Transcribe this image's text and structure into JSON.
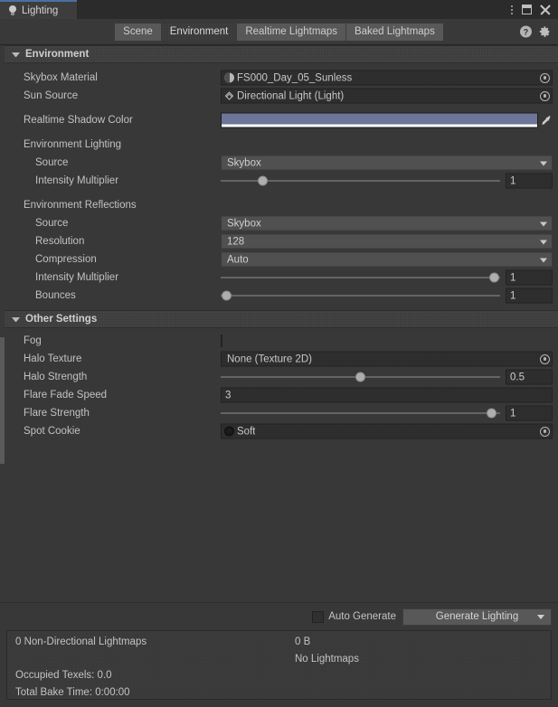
{
  "window": {
    "tab_title": "Lighting",
    "tab_icon": "lightbulb-icon",
    "controls": {
      "menu": "kebab-menu-icon",
      "maximize": "maximize-icon",
      "close": "close-icon"
    }
  },
  "toolbar": {
    "tabs": [
      {
        "label": "Scene",
        "active": false
      },
      {
        "label": "Environment",
        "active": true
      },
      {
        "label": "Realtime Lightmaps",
        "active": false
      },
      {
        "label": "Baked Lightmaps",
        "active": false
      }
    ],
    "help_label": "?",
    "help_icon": "help-icon",
    "settings_icon": "gear-icon"
  },
  "sections": {
    "environment": {
      "title": "Environment",
      "skybox_material": {
        "label": "Skybox Material",
        "value": "FS000_Day_05_Sunless",
        "icon": "material-icon"
      },
      "sun_source": {
        "label": "Sun Source",
        "value": "Directional Light (Light)",
        "icon": "light-icon"
      },
      "realtime_shadow_color": {
        "label": "Realtime Shadow Color",
        "color": "#6d7599",
        "alpha_color": "#ffffff",
        "eyedropper_icon": "eyedropper-icon"
      },
      "environment_lighting": {
        "title": "Environment Lighting",
        "source": {
          "label": "Source",
          "value": "Skybox"
        },
        "intensity_multiplier": {
          "label": "Intensity Multiplier",
          "value": "1",
          "slider_percent": 15
        }
      },
      "environment_reflections": {
        "title": "Environment Reflections",
        "source": {
          "label": "Source",
          "value": "Skybox"
        },
        "resolution": {
          "label": "Resolution",
          "value": "128"
        },
        "compression": {
          "label": "Compression",
          "value": "Auto"
        },
        "intensity_multiplier": {
          "label": "Intensity Multiplier",
          "value": "1",
          "slider_percent": 98
        },
        "bounces": {
          "label": "Bounces",
          "value": "1",
          "slider_percent": 2
        }
      }
    },
    "other_settings": {
      "title": "Other Settings",
      "fog": {
        "label": "Fog",
        "checked": false
      },
      "halo_texture": {
        "label": "Halo Texture",
        "value": "None (Texture 2D)"
      },
      "halo_strength": {
        "label": "Halo Strength",
        "value": "0.5",
        "slider_percent": 50
      },
      "flare_fade_speed": {
        "label": "Flare Fade Speed",
        "value": "3"
      },
      "flare_strength": {
        "label": "Flare Strength",
        "value": "1",
        "slider_percent": 97
      },
      "spot_cookie": {
        "label": "Spot Cookie",
        "value": "Soft",
        "icon": "cookie-icon"
      }
    }
  },
  "footer": {
    "auto_generate": {
      "label": "Auto Generate",
      "checked": false
    },
    "generate_button": {
      "label": "Generate Lighting"
    },
    "stats": {
      "lightmaps_count": "0 Non-Directional Lightmaps",
      "lightmaps_size": "0 B",
      "lightmaps_status": "No Lightmaps",
      "occupied_texels": "Occupied Texels: 0.0",
      "total_bake_time": "Total Bake Time: 0:00:00"
    }
  },
  "colors": {
    "accent": "#4a6fa5",
    "panel": "#383838",
    "header": "#3f3f3f"
  }
}
